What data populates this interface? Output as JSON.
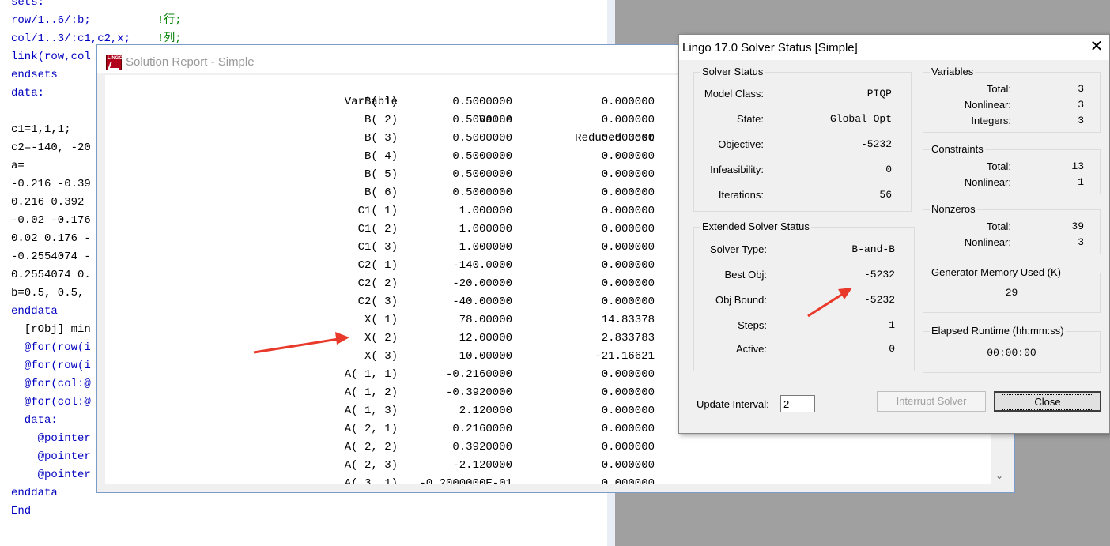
{
  "editor": {
    "lines": [
      "sets:",
      "row/1..6/:b;          !行;",
      "col/1..3/:c1,c2,x;    !列;",
      "link(row,col",
      "endsets",
      "data:",
      "",
      "c1=1,1,1;",
      "c2=-140, -20",
      "a=",
      "-0.216 -0.39",
      "0.216 0.392",
      "-0.02 -0.176",
      "0.02 0.176 -",
      "-0.2554074 -",
      "0.2554074 0.",
      "b=0.5, 0.5,",
      "enddata",
      "  [rObj] min",
      "  @for(row(i",
      "  @for(row(i",
      "  @for(col:@",
      "  @for(col:@",
      "  data:",
      "    @pointer",
      "    @pointer",
      "    @pointer",
      "enddata",
      "End"
    ]
  },
  "report": {
    "title": "Solution Report - Simple",
    "logo_text": "LINGO",
    "headers": [
      "Variable",
      "Value",
      "Reduced Cost"
    ],
    "rows": [
      [
        "B( 1)",
        "0.5000000",
        "0.000000"
      ],
      [
        "B( 2)",
        "0.5000000",
        "0.000000"
      ],
      [
        "B( 3)",
        "0.5000000",
        "0.000000"
      ],
      [
        "B( 4)",
        "0.5000000",
        "0.000000"
      ],
      [
        "B( 5)",
        "0.5000000",
        "0.000000"
      ],
      [
        "B( 6)",
        "0.5000000",
        "0.000000"
      ],
      [
        "C1( 1)",
        "1.000000",
        "0.000000"
      ],
      [
        "C1( 2)",
        "1.000000",
        "0.000000"
      ],
      [
        "C1( 3)",
        "1.000000",
        "0.000000"
      ],
      [
        "C2( 1)",
        "-140.0000",
        "0.000000"
      ],
      [
        "C2( 2)",
        "-20.00000",
        "0.000000"
      ],
      [
        "C2( 3)",
        "-40.00000",
        "0.000000"
      ],
      [
        "X( 1)",
        "78.00000",
        "14.83378"
      ],
      [
        "X( 2)",
        "12.00000",
        "2.833783"
      ],
      [
        "X( 3)",
        "10.00000",
        "-21.16621"
      ],
      [
        "A( 1, 1)",
        "-0.2160000",
        "0.000000"
      ],
      [
        "A( 1, 2)",
        "-0.3920000",
        "0.000000"
      ],
      [
        "A( 1, 3)",
        "2.120000",
        "0.000000"
      ],
      [
        "A( 2, 1)",
        "0.2160000",
        "0.000000"
      ],
      [
        "A( 2, 2)",
        "0.3920000",
        "0.000000"
      ],
      [
        "A( 2, 3)",
        "-2.120000",
        "0.000000"
      ],
      [
        "A( 3, 1)",
        "-0.2000000E-01",
        "0.000000"
      ]
    ]
  },
  "solver": {
    "title": "Lingo 17.0 Solver Status [Simple]",
    "close_glyph": "✕",
    "status": {
      "title": "Solver Status",
      "model_class_label": "Model Class:",
      "model_class": "PIQP",
      "state_label": "State:",
      "state": "Global Opt",
      "objective_label": "Objective:",
      "objective": "-5232",
      "infeasibility_label": "Infeasibility:",
      "infeasibility": "0",
      "iterations_label": "Iterations:",
      "iterations": "56"
    },
    "extended": {
      "title": "Extended Solver Status",
      "type_label": "Solver Type:",
      "type": "B-and-B",
      "best_label": "Best Obj:",
      "best": "-5232",
      "bound_label": "Obj Bound:",
      "bound": "-5232",
      "steps_label": "Steps:",
      "steps": "1",
      "active_label": "Active:",
      "active": "0"
    },
    "variables": {
      "title": "Variables",
      "total_label": "Total:",
      "total": "3",
      "nonlinear_label": "Nonlinear:",
      "nonlinear": "3",
      "integers_label": "Integers:",
      "integers": "3"
    },
    "constraints": {
      "title": "Constraints",
      "total_label": "Total:",
      "total": "13",
      "nonlinear_label": "Nonlinear:",
      "nonlinear": "1"
    },
    "nonzeros": {
      "title": "Nonzeros",
      "total_label": "Total:",
      "total": "39",
      "nonlinear_label": "Nonlinear:",
      "nonlinear": "3"
    },
    "memory": {
      "title": "Generator Memory Used (K)",
      "value": "29"
    },
    "runtime": {
      "title": "Elapsed Runtime (hh:mm:ss)",
      "value": "00:00:00"
    },
    "update_label": "Update Interval:",
    "update_value": "2",
    "interrupt_label": "Interrupt Solver",
    "close_label": "Close"
  },
  "colors": {
    "arrow": "#e8392b",
    "keyword": "#0000c0",
    "comment": "#008000"
  }
}
